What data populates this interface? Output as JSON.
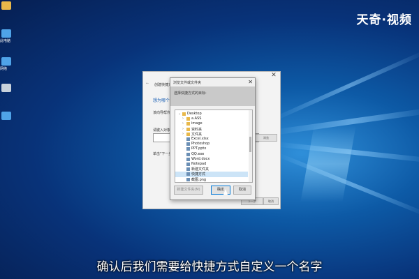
{
  "watermark": "天奇·视频",
  "subtitle": "确认后我们需要给快捷方式自定义一个名字",
  "desktop_icons": [
    {
      "icon": "folder-icon",
      "label": "",
      "color": "#e8b84a"
    },
    {
      "icon": "this-pc-icon",
      "label": "此电脑",
      "color": "#4fa3e8"
    },
    {
      "icon": "network-icon",
      "label": "网络",
      "color": "#4fa3e8"
    },
    {
      "icon": "recycle-bin-icon",
      "label": "",
      "color": "#c8d2dc"
    },
    {
      "icon": "control-panel-icon",
      "label": "",
      "color": "#4fa3e8"
    }
  ],
  "wizard": {
    "title": "创建快捷方式",
    "close": "✕",
    "heading": "想为哪个对",
    "description": "该向导帮你创建",
    "location_label": "请键入对象的位置",
    "next_hint": "单击\"下一步\"",
    "browse_label": "浏览",
    "next_label": "下一步",
    "cancel_label": "取消"
  },
  "dialog": {
    "title": "浏览文件或文件夹",
    "close": "✕",
    "instruction": "选择快捷方式的目标:",
    "tree": [
      {
        "label": "Desktop",
        "icon": "folder-icon",
        "expanded": true,
        "indent": 0,
        "selected": false
      },
      {
        "label": "a.ASS",
        "icon": "folder-icon",
        "expanded": false,
        "indent": 1,
        "selected": false
      },
      {
        "label": "image",
        "icon": "folder-icon",
        "expanded": false,
        "indent": 1,
        "selected": false
      },
      {
        "label": "资料夹",
        "icon": "folder-icon",
        "expanded": false,
        "indent": 1,
        "selected": false
      },
      {
        "label": "文件夹",
        "icon": "folder-icon",
        "expanded": false,
        "indent": 1,
        "selected": false
      },
      {
        "label": "Excel.xlsx",
        "icon": "file-icon",
        "expanded": null,
        "indent": 1,
        "selected": false
      },
      {
        "label": "Photoshop",
        "icon": "file-icon",
        "expanded": null,
        "indent": 1,
        "selected": false
      },
      {
        "label": "PPT.pptx",
        "icon": "file-icon",
        "expanded": null,
        "indent": 1,
        "selected": false
      },
      {
        "label": "QQ.exe",
        "icon": "file-icon",
        "expanded": null,
        "indent": 1,
        "selected": false
      },
      {
        "label": "Word.docx",
        "icon": "file-icon",
        "expanded": null,
        "indent": 1,
        "selected": false
      },
      {
        "label": "Notepad",
        "icon": "file-icon",
        "expanded": null,
        "indent": 1,
        "selected": false
      },
      {
        "label": "新建文件夹",
        "icon": "file-icon",
        "expanded": null,
        "indent": 1,
        "selected": false
      },
      {
        "label": "快捷方式",
        "icon": "file-icon",
        "expanded": null,
        "indent": 1,
        "selected": true
      },
      {
        "label": "截图.png",
        "icon": "file-icon",
        "expanded": null,
        "indent": 1,
        "selected": false
      }
    ],
    "new_folder_label": "新建文件夹(M)",
    "ok_label": "确定",
    "cancel_label": "取消"
  },
  "colors": {
    "accent": "#0078d7",
    "selection": "#cce4f7",
    "folder": "#e8b84a",
    "file": "#6b8fb5"
  }
}
